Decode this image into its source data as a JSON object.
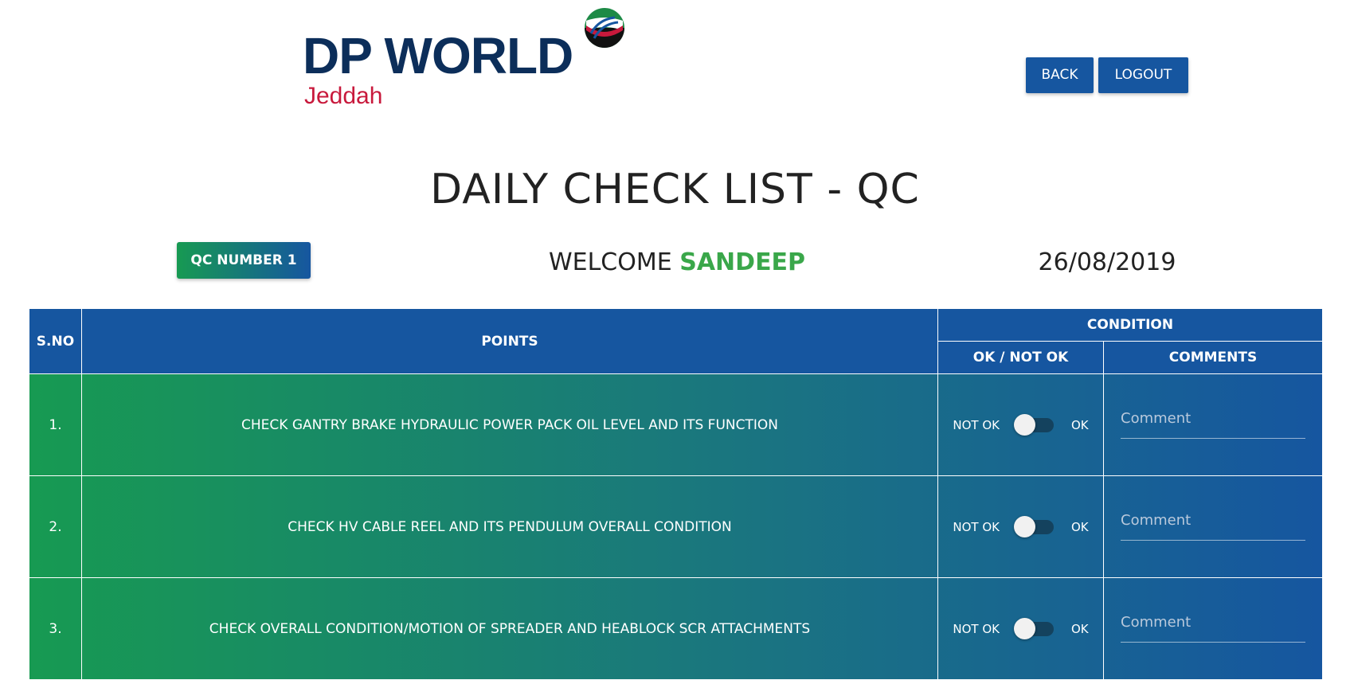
{
  "logo": {
    "word": "DP WORLD",
    "city": "Jeddah",
    "emblem_icon": "flag-emblem-icon"
  },
  "header": {
    "back_label": "BACK",
    "logout_label": "LOGOUT"
  },
  "page": {
    "title": "DAILY CHECK LIST - QC"
  },
  "info": {
    "qc_number": "QC NUMBER 1",
    "welcome_prefix": "WELCOME",
    "user_name": "SANDEEP",
    "date": "26/08/2019"
  },
  "table": {
    "headers": {
      "sno": "S.NO",
      "points": "POINTS",
      "condition": "CONDITION",
      "ok_not_ok": "OK / NOT OK",
      "comments": "COMMENTS"
    },
    "toggle": {
      "off_label": "NOT OK",
      "on_label": "OK"
    },
    "comment_placeholder": "Comment",
    "rows": [
      {
        "sno": "1.",
        "point": "CHECK GANTRY BRAKE HYDRAULIC POWER PACK OIL LEVEL AND ITS FUNCTION",
        "ok": false
      },
      {
        "sno": "2.",
        "point": "CHECK HV CABLE REEL AND ITS PENDULUM OVERALL CONDITION",
        "ok": false
      },
      {
        "sno": "3.",
        "point": "CHECK OVERALL CONDITION/MOTION OF SPREADER AND HEABLOCK SCR ATTACHMENTS",
        "ok": false
      }
    ]
  },
  "colors": {
    "primary_blue": "#1656a0",
    "green": "#179a52",
    "logo_navy": "#0c2e5a",
    "logo_red": "#c8193c",
    "welcome_green": "#3aa74a"
  }
}
